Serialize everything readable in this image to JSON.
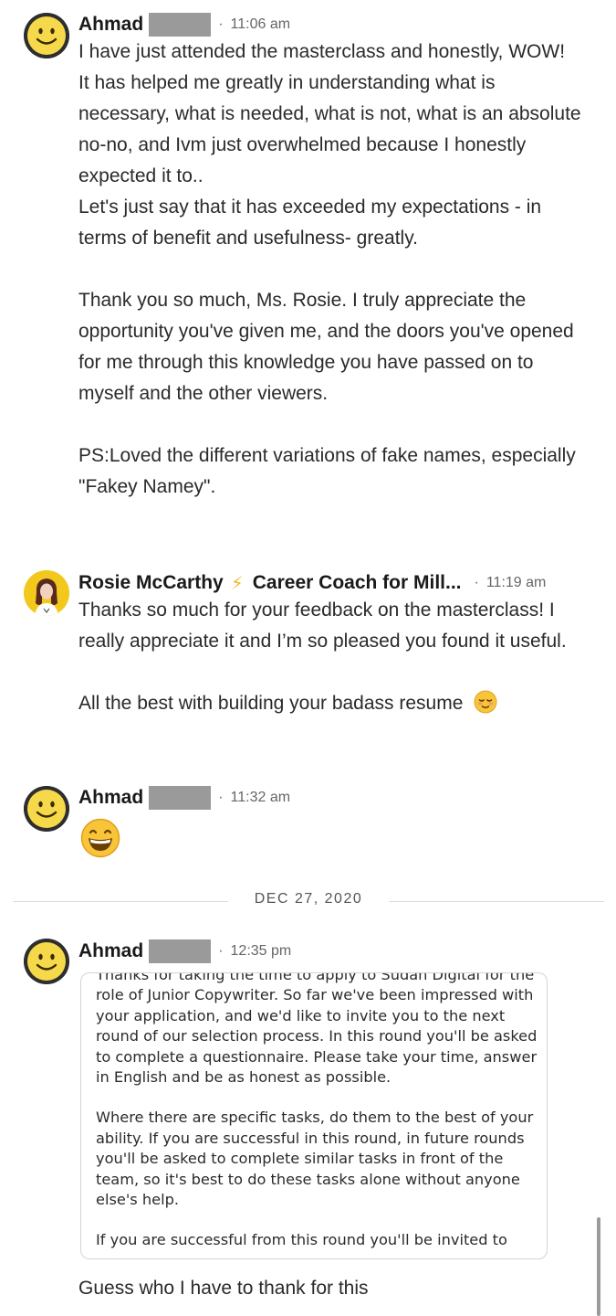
{
  "messages": [
    {
      "sender": "Ahmad",
      "time": "11:06 am",
      "paragraphs": [
        "I have just attended the masterclass and honestly, WOW!",
        "It has helped me greatly in understanding what is necessary, what is needed, what is not, what is an absolute no-no, and Ivm just overwhelmed because I honestly expected it to..",
        "Let's just say that it has exceeded my expectations - in terms of benefit and usefulness- greatly.",
        "",
        "Thank you so much, Ms. Rosie. I truly appreciate the opportunity you've given me, and the doors you've opened for me through this knowledge you have passed on to myself and the other viewers.",
        "",
        "PS:Loved the different variations of fake names, especially \"Fakey Namey\"."
      ]
    },
    {
      "sender": "Rosie McCarthy",
      "headline": "Career Coach for Mill...",
      "time": "11:19 am",
      "paragraphs": [
        "Thanks so much for your feedback on the masterclass! I really appreciate it and I’m so pleased you found it useful.",
        "",
        "All the best with building your badass resume"
      ],
      "trailing_emoji": "relieved-face-emoji"
    },
    {
      "sender": "Ahmad",
      "time": "11:32 am",
      "emoji": "grinning-face-emoji"
    },
    {
      "sender": "Ahmad",
      "time": "12:35 pm",
      "attachment": {
        "paragraphs": [
          "Thanks for taking the time to apply to Sudan Digital for the role of Junior Copywriter. So far we've been impressed with your application, and we'd like to invite you to the next round of our selection process. In this round you'll be asked to complete a questionnaire. Please take your time, answer in English and be as honest as possible.",
          "",
          "Where there are specific tasks, do them to the best of your ability. If you are successful in this round, in future rounds you'll be asked to complete similar tasks in front of the team, so it's best to do these tasks alone without anyone else's help.",
          "",
          "If you are successful from this round you'll be invited to"
        ]
      },
      "caption": "Guess who I have to thank for this"
    }
  ],
  "date_divider": "DEC 27, 2020",
  "icons": {
    "separator": "·",
    "headline_separator": "⚡"
  },
  "colors": {
    "smiley_yellow": "#f6d94a",
    "bolt": "#f5b62a",
    "redaction": "#9a9a9a"
  }
}
